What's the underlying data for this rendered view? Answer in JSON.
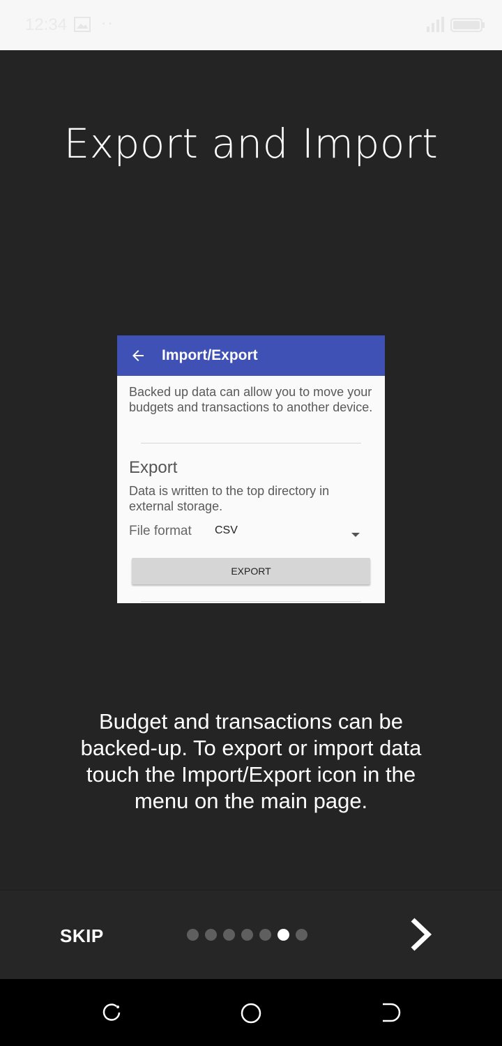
{
  "status_bar": {
    "time": "12:34",
    "icons": [
      "image-icon",
      "more-dots",
      "signal-icon",
      "battery-icon"
    ]
  },
  "page": {
    "title": "Export and Import",
    "description": "Budget and transactions can be backed-up. To export or import data touch the Import/Export icon in the menu on the main page."
  },
  "screenshot": {
    "toolbar_title": "Import/Export",
    "intro": "Backed up data can allow you to move your budgets and transactions to another device.",
    "export_heading": "Export",
    "export_description": "Data is written to the top directory in external storage.",
    "file_format_label": "File format",
    "file_format_value": "CSV",
    "export_button": "EXPORT",
    "toolbar_color": "#3f51b5"
  },
  "bottom_bar": {
    "skip_label": "SKIP",
    "page_count": 7,
    "current_page": 6,
    "next_icon": "chevron-right-icon"
  },
  "nav_bar": {
    "buttons": [
      "recents-icon",
      "home-icon",
      "back-icon"
    ]
  }
}
